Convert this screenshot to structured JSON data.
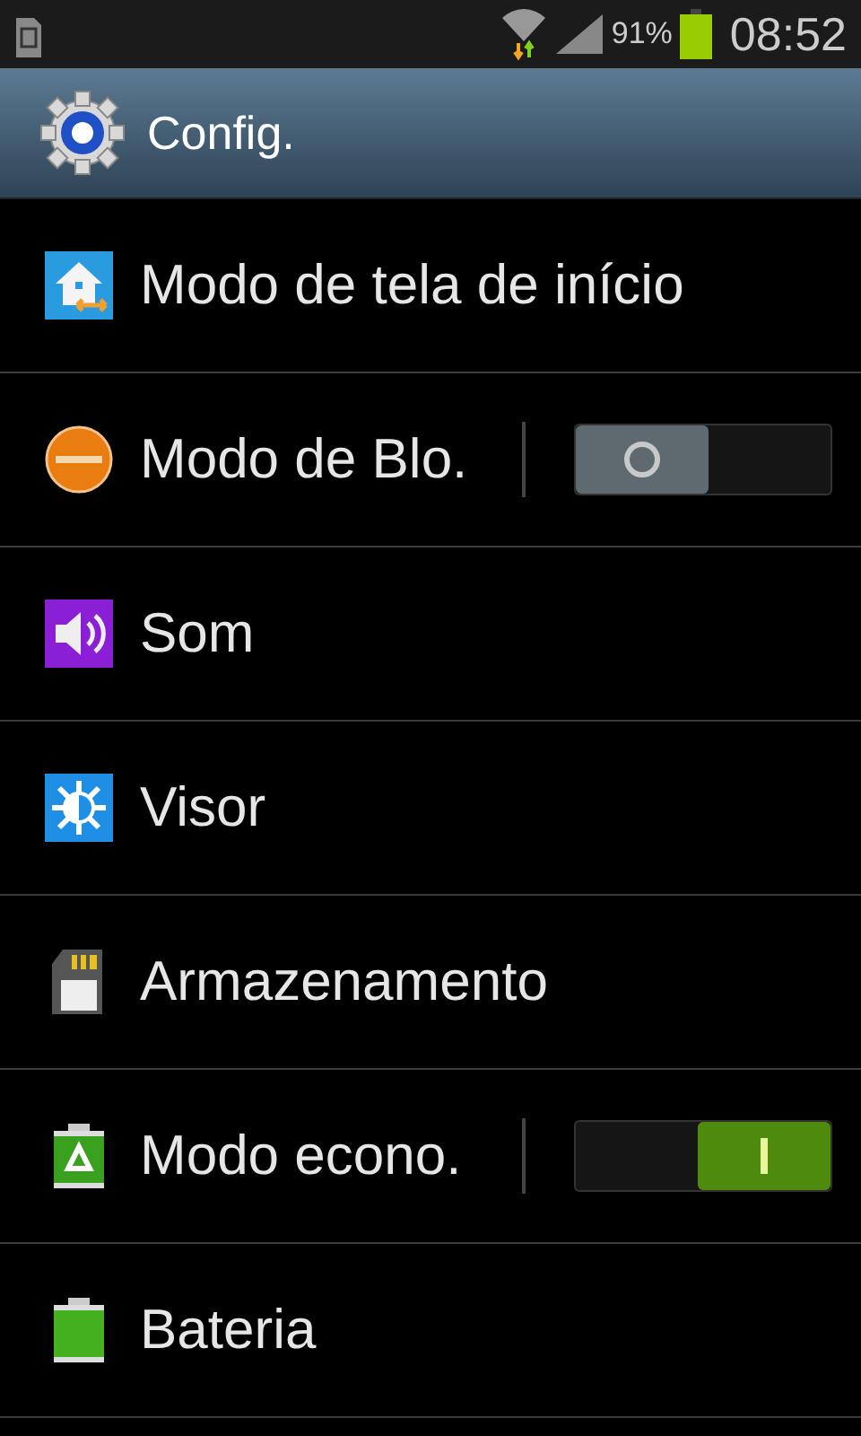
{
  "status_bar": {
    "battery_percent": "91%",
    "time": "08:52"
  },
  "header": {
    "title": "Config."
  },
  "items": [
    {
      "label": "Modo de tela de início",
      "kind": "link"
    },
    {
      "label": "Modo de Blo.",
      "kind": "toggle",
      "on": false
    },
    {
      "label": "Som",
      "kind": "link"
    },
    {
      "label": "Visor",
      "kind": "link"
    },
    {
      "label": "Armazenamento",
      "kind": "link"
    },
    {
      "label": "Modo econo.",
      "kind": "toggle",
      "on": true
    },
    {
      "label": "Bateria",
      "kind": "link"
    }
  ]
}
